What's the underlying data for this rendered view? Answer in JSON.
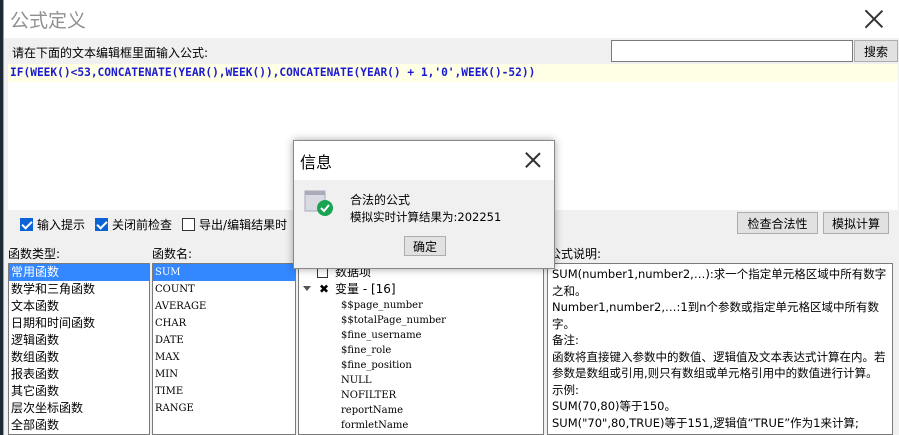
{
  "window": {
    "title": "公式定义"
  },
  "prompt_label": "请在下面的文本编辑框里面输入公式:",
  "search": {
    "placeholder": "",
    "button": "搜索"
  },
  "formula": "IF(WEEK()<53,CONCATENATE(YEAR(),WEEK()),CONCATENATE(YEAR() + 1,'0',WEEK()-52))",
  "options": [
    {
      "label": "输入提示",
      "checked": true
    },
    {
      "label": "关闭前检查",
      "checked": true
    },
    {
      "label": "导出/编辑结果时",
      "checked": false
    }
  ],
  "buttons": {
    "check": "检查合法性",
    "simulate": "模拟计算"
  },
  "headers": {
    "func_type": "函数类型:",
    "func_name": "函数名:",
    "desc": "公式说明:"
  },
  "func_types": [
    "常用函数",
    "数学和三角函数",
    "文本函数",
    "日期和时间函数",
    "逻辑函数",
    "数组函数",
    "报表函数",
    "其它函数",
    "层次坐标函数",
    "全部函数"
  ],
  "func_names": [
    "SUM",
    "COUNT",
    "AVERAGE",
    "CHAR",
    "DATE",
    "MAX",
    "MIN",
    "TIME",
    "RANGE"
  ],
  "tree": {
    "dataset": "数据项",
    "variables": "变量 - [16]",
    "vars": [
      "$$page_number",
      "$$totalPage_number",
      "$fine_username",
      "$fine_role",
      "$fine_position",
      "NULL",
      "NOFILTER",
      "reportName",
      "formletName"
    ]
  },
  "description": [
    "SUM(number1,number2,…):求一个指定单元格区域中所有数字之和。",
    "Number1,number2,…:1到n个参数或指定单元格区域中所有数字。",
    "备注:",
    "函数将直接键入参数中的数值、逻辑值及文本表达式计算在内。若参数是数组或引用,则只有数组或单元格引用中的数值进行计算。",
    "示例:",
    "SUM(70,80)等于150。",
    "SUM(\"70\",80,TRUE)等于151,逻辑值“TRUE”作为1来计算;"
  ],
  "modal": {
    "title": "信息",
    "line1": "合法的公式",
    "line2": "模拟实时计算结果为:202251",
    "ok": "确定"
  }
}
